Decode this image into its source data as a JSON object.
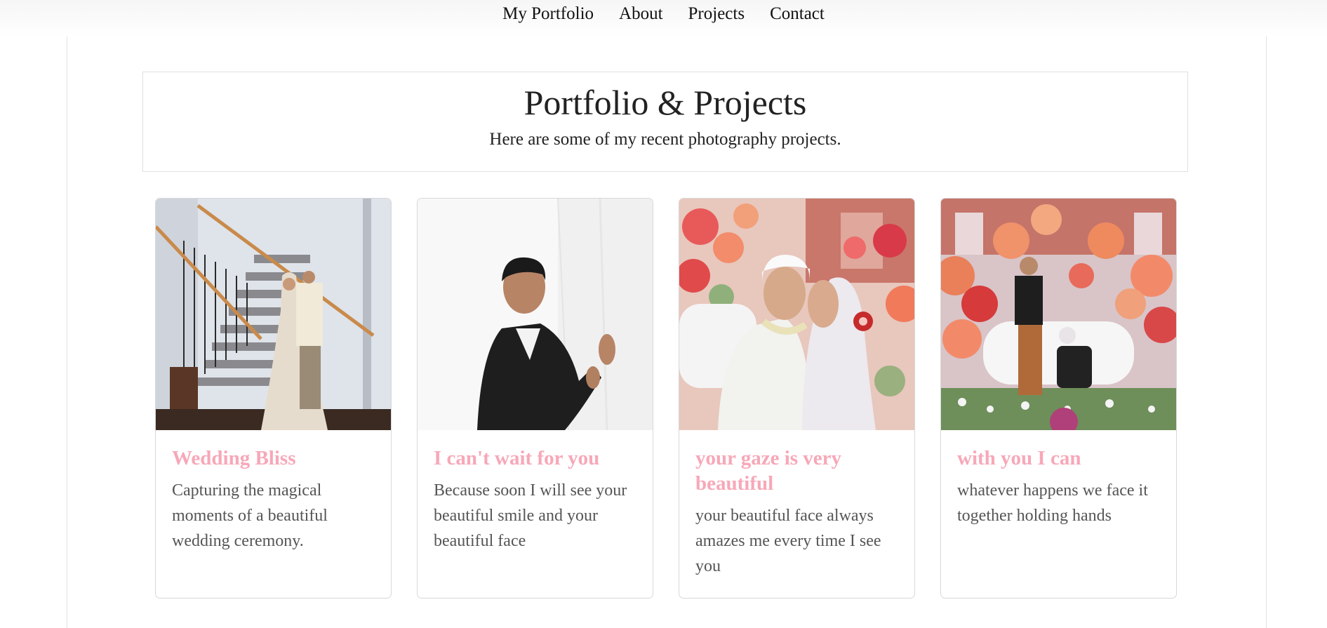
{
  "nav": {
    "items": [
      "My Portfolio",
      "About",
      "Projects",
      "Contact"
    ]
  },
  "hero": {
    "title": "Portfolio & Projects",
    "subtitle": "Here are some of my recent photography projects."
  },
  "cards": [
    {
      "title": "Wedding Bliss",
      "description": "Capturing the magical moments of a beautiful wedding ceremony.",
      "image": "wedding-couple-on-staircase-photo"
    },
    {
      "title": "I can't wait for you",
      "description": "Because soon I will see your beautiful smile and your beautiful face",
      "image": "groom-adjusting-cufflink-photo"
    },
    {
      "title": "your gaze is very beautiful",
      "description": "your beautiful face always amazes me every time I see you",
      "image": "couple-face-to-face-flowers-photo"
    },
    {
      "title": "with you I can",
      "description": "whatever happens we face it together holding hands",
      "image": "couple-on-floral-stage-photo"
    }
  ],
  "colors": {
    "card_title": "#f7a8b8",
    "card_text": "#555555",
    "border": "#d8d8d8"
  }
}
